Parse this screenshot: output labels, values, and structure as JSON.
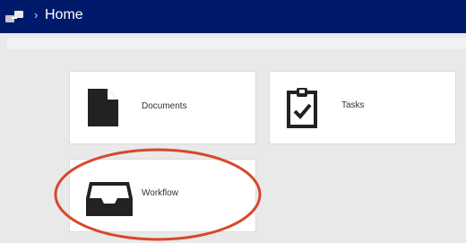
{
  "header": {
    "breadcrumb_separator": "›",
    "title": "Home"
  },
  "tiles": [
    {
      "label": "Documents",
      "icon": "document-icon"
    },
    {
      "label": "Tasks",
      "icon": "clipboard-check-icon"
    },
    {
      "label": "Workflow",
      "icon": "inbox-tray-icon"
    }
  ],
  "colors": {
    "header_bg": "#001a6b",
    "page_bg": "#e9e9e9",
    "tile_bg": "#ffffff",
    "annotation": "#d9472b"
  }
}
